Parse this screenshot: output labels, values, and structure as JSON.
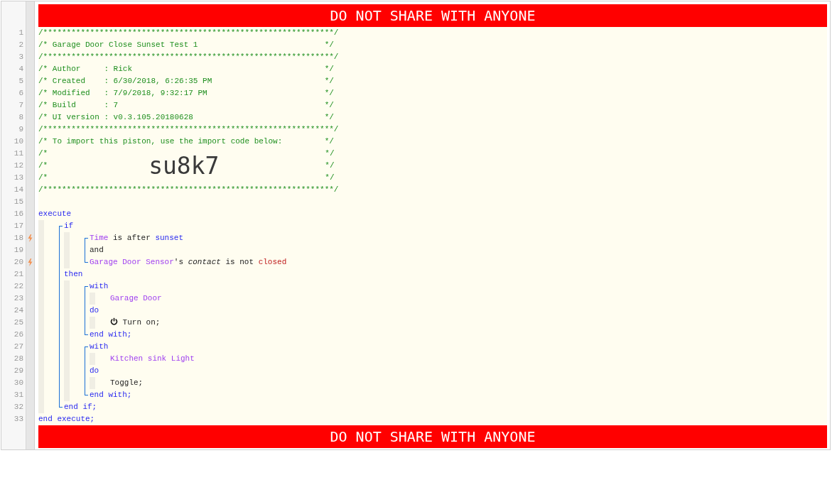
{
  "banner_top": "DO NOT SHARE WITH ANYONE",
  "header": [
    {
      "kind": "comment",
      "number": "1",
      "text": "/**************************************************************/"
    },
    {
      "kind": "comment",
      "number": "2",
      "text": "/* Garage Door Close Sunset Test 1                           */"
    },
    {
      "kind": "comment",
      "number": "3",
      "text": "/**************************************************************/"
    },
    {
      "kind": "comment",
      "number": "4",
      "text": "/* Author     : Rick                                         */"
    },
    {
      "kind": "comment",
      "number": "5",
      "text": "/* Created    : 6/30/2018, 6:26:35 PM                        */"
    },
    {
      "kind": "comment",
      "number": "6",
      "text": "/* Modified   : 7/9/2018, 9:32:17 PM                         */"
    },
    {
      "kind": "comment",
      "number": "7",
      "text": "/* Build      : 7                                            */"
    },
    {
      "kind": "comment",
      "number": "8",
      "text": "/* UI version : v0.3.105.20180628                            */"
    },
    {
      "kind": "comment",
      "number": "9",
      "text": "/**************************************************************/"
    },
    {
      "kind": "comment",
      "number": "10",
      "text": "/* To import this piston, use the import code below:         */"
    },
    {
      "kind": "import_code",
      "numbers": [
        "11",
        "12",
        "13"
      ],
      "prefix": [
        "/*",
        "/*",
        "/*"
      ],
      "code": "su8k7",
      "suffix": [
        "*/",
        "*/",
        "*/"
      ]
    },
    {
      "kind": "comment",
      "number": "14",
      "text": "/**************************************************************/"
    },
    {
      "kind": "blank",
      "number": "15"
    }
  ],
  "program": [
    {
      "kind": "line",
      "number": "16",
      "trigger": false,
      "tokens": [
        {
          "kind": "keyword",
          "text": "execute"
        }
      ]
    },
    {
      "kind": "indent",
      "items": [
        {
          "kind": "block",
          "items": [
            {
              "kind": "line",
              "number": "17",
              "trigger": false,
              "tokens": [
                {
                  "kind": "keyword",
                  "text": "if"
                }
              ]
            },
            {
              "kind": "indent",
              "items": [
                {
                  "kind": "block",
                  "items": [
                    {
                      "kind": "line",
                      "number": "18",
                      "trigger": true,
                      "tokens": [
                        {
                          "kind": "device",
                          "text": "Time"
                        },
                        {
                          "kind": "plain",
                          "text": " is after "
                        },
                        {
                          "kind": "keyword",
                          "text": "sunset"
                        }
                      ]
                    },
                    {
                      "kind": "line",
                      "number": "19",
                      "trigger": false,
                      "tokens": [
                        {
                          "kind": "plain",
                          "text": "and"
                        }
                      ]
                    },
                    {
                      "kind": "line",
                      "number": "20",
                      "trigger": true,
                      "tokens": [
                        {
                          "kind": "device",
                          "text": "Garage Door Sensor"
                        },
                        {
                          "kind": "plain",
                          "text": "'s "
                        },
                        {
                          "kind": "attribute",
                          "text": "contact"
                        },
                        {
                          "kind": "plain",
                          "text": " is not "
                        },
                        {
                          "kind": "value",
                          "text": "closed"
                        }
                      ]
                    }
                  ]
                }
              ]
            },
            {
              "kind": "line",
              "number": "21",
              "trigger": false,
              "tokens": [
                {
                  "kind": "keyword",
                  "text": "then"
                }
              ]
            },
            {
              "kind": "indent",
              "items": [
                {
                  "kind": "block",
                  "items": [
                    {
                      "kind": "line",
                      "number": "22",
                      "trigger": false,
                      "tokens": [
                        {
                          "kind": "keyword",
                          "text": "with"
                        }
                      ]
                    },
                    {
                      "kind": "indent",
                      "items": [
                        {
                          "kind": "line",
                          "number": "23",
                          "trigger": false,
                          "tokens": [
                            {
                              "kind": "device",
                              "text": "Garage Door"
                            }
                          ]
                        }
                      ]
                    },
                    {
                      "kind": "line",
                      "number": "24",
                      "trigger": false,
                      "tokens": [
                        {
                          "kind": "keyword",
                          "text": "do"
                        }
                      ]
                    },
                    {
                      "kind": "indent",
                      "items": [
                        {
                          "kind": "line",
                          "number": "25",
                          "trigger": false,
                          "tokens": [
                            {
                              "kind": "power"
                            },
                            {
                              "kind": "plain",
                              "text": " Turn on;"
                            }
                          ]
                        }
                      ]
                    },
                    {
                      "kind": "line",
                      "number": "26",
                      "trigger": false,
                      "tokens": [
                        {
                          "kind": "keyword",
                          "text": "end with;"
                        }
                      ]
                    }
                  ]
                },
                {
                  "kind": "block",
                  "items": [
                    {
                      "kind": "line",
                      "number": "27",
                      "trigger": false,
                      "tokens": [
                        {
                          "kind": "keyword",
                          "text": "with"
                        }
                      ]
                    },
                    {
                      "kind": "indent",
                      "items": [
                        {
                          "kind": "line",
                          "number": "28",
                          "trigger": false,
                          "tokens": [
                            {
                              "kind": "device",
                              "text": "Kitchen sink Light"
                            }
                          ]
                        }
                      ]
                    },
                    {
                      "kind": "line",
                      "number": "29",
                      "trigger": false,
                      "tokens": [
                        {
                          "kind": "keyword",
                          "text": "do"
                        }
                      ]
                    },
                    {
                      "kind": "indent",
                      "items": [
                        {
                          "kind": "line",
                          "number": "30",
                          "trigger": false,
                          "tokens": [
                            {
                              "kind": "plain",
                              "text": "Toggle;"
                            }
                          ]
                        }
                      ]
                    },
                    {
                      "kind": "line",
                      "number": "31",
                      "trigger": false,
                      "tokens": [
                        {
                          "kind": "keyword",
                          "text": "end with;"
                        }
                      ]
                    }
                  ]
                }
              ]
            },
            {
              "kind": "line",
              "number": "32",
              "trigger": false,
              "tokens": [
                {
                  "kind": "keyword",
                  "text": "end if;"
                }
              ]
            }
          ]
        }
      ]
    },
    {
      "kind": "line",
      "number": "33",
      "trigger": false,
      "tokens": [
        {
          "kind": "keyword",
          "text": "end execute;"
        }
      ]
    }
  ],
  "banner_bottom": "DO NOT SHARE WITH ANYONE"
}
